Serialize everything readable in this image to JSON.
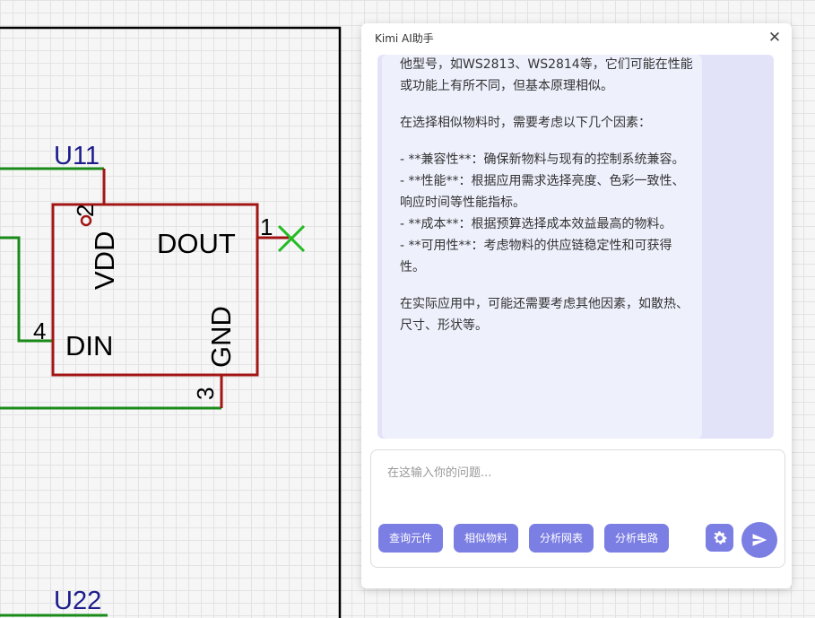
{
  "schematic": {
    "u11": {
      "designator": "U11",
      "pins": {
        "vdd_number": "2",
        "vdd_name": "VDD",
        "dout_number": "1",
        "dout_name": "DOUT",
        "din_number": "4",
        "din_name": "DIN",
        "gnd_number": "3",
        "gnd_name": "GND"
      }
    },
    "u22": {
      "designator": "U22"
    },
    "colors": {
      "wire": "#1a8a1a",
      "component": "#a31515",
      "designator": "#1c1c8c",
      "no_connect": "#22bb22",
      "frame": "#000000"
    }
  },
  "panel": {
    "title": "Kimi AI助手",
    "close_icon": "close-icon",
    "messages": [
      "他型号，如WS2813、WS2814等，它们可能在性能或功能上有所不同，但基本原理相似。",
      "在选择相似物料时，需要考虑以下几个因素：",
      "- **兼容性**：确保新物料与现有的控制系统兼容。\n- **性能**：根据应用需求选择亮度、色彩一致性、响应时间等性能指标。\n- **成本**：根据预算选择成本效益最高的物料。\n- **可用性**：考虑物料的供应链稳定性和可获得性。",
      "在实际应用中，可能还需要考虑其他因素，如散热、尺寸、形状等。"
    ],
    "input": {
      "placeholder": "在这输入你的问题...",
      "value": ""
    },
    "quick_actions": {
      "query_component": "查询元件",
      "similar_material": "相似物料",
      "analyze_netlist": "分析网表",
      "analyze_circuit": "分析电路"
    },
    "settings_icon": "gear-icon",
    "send_icon": "send-icon",
    "accent_color": "#7b7ee3"
  }
}
